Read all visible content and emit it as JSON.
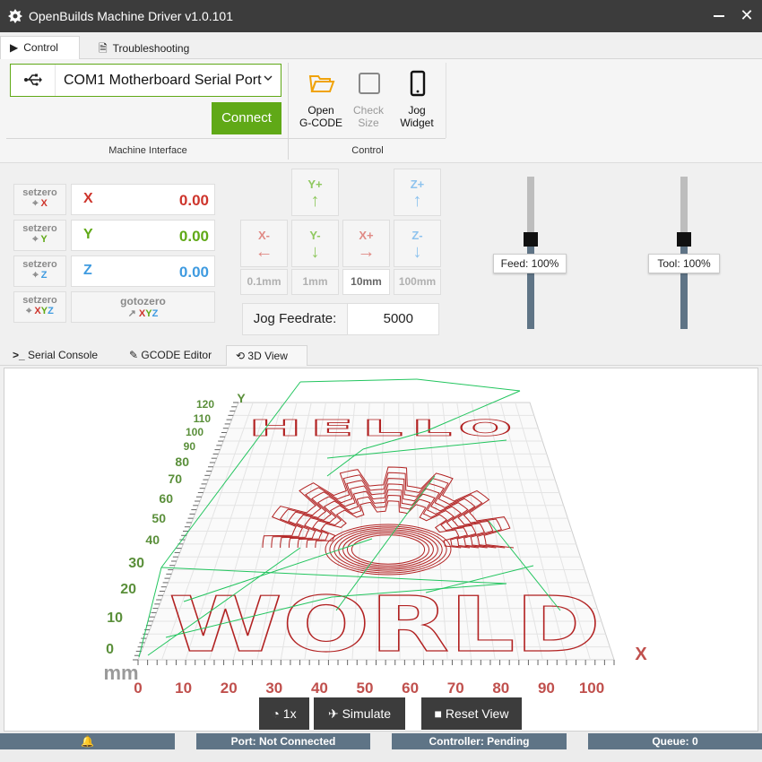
{
  "window": {
    "title": "OpenBuilds Machine Driver v1.0.101",
    "close_glyph": "✕"
  },
  "tabs": [
    {
      "label": "Control",
      "icon": "play-icon"
    },
    {
      "label": "Troubleshooting",
      "icon": "document-icon"
    }
  ],
  "machine": {
    "port_value": "COM1 Motherboard Serial Port",
    "connect_label": "Connect",
    "group_label": "Machine Interface"
  },
  "control": {
    "group_label": "Control",
    "open_label_1": "Open",
    "open_label_2": "G-CODE",
    "check_label_1": "Check",
    "check_label_2": "Size",
    "jog_label_1": "Jog",
    "jog_label_2": "Widget"
  },
  "dro": {
    "setzero_label": "setzero",
    "gotozero_label": "gotozero",
    "axes": [
      {
        "axis": "X",
        "value": "0.00",
        "color": "#ce352c"
      },
      {
        "axis": "Y",
        "value": "0.00",
        "color": "#60a917"
      },
      {
        "axis": "Z",
        "value": "0.00",
        "color": "#3f9be0"
      }
    ],
    "xyz_label": "XYZ"
  },
  "jog": {
    "buttons": {
      "yplus": "Y+",
      "zplus": "Z+",
      "xminus": "X-",
      "yminus": "Y-",
      "xplus": "X+",
      "zminus": "Z-"
    },
    "steps": [
      "0.1mm",
      "1mm",
      "10mm",
      "100mm"
    ],
    "selected_step": "10mm",
    "feedrate_label": "Jog Feedrate:",
    "feedrate_value": "5000"
  },
  "overrides": {
    "feed_label": "Feed: 100%",
    "feed_percent": 100,
    "tool_label": "Tool: 100%",
    "tool_percent": 100
  },
  "subtabs": [
    {
      "label": "Serial Console",
      "icon": "terminal-icon"
    },
    {
      "label": "GCODE Editor",
      "icon": "edit-icon"
    },
    {
      "label": "3D View",
      "icon": "cube-icon"
    }
  ],
  "view3d": {
    "x_axis_label": "X",
    "y_axis_label": "Y",
    "unit_label": "mm",
    "x_ticks": [
      "0",
      "10",
      "20",
      "30",
      "40",
      "50",
      "60",
      "70",
      "80",
      "90",
      "100"
    ],
    "y_ticks": [
      "0",
      "10",
      "20",
      "30",
      "40",
      "50",
      "60",
      "70",
      "80",
      "90",
      "100",
      "110",
      "120"
    ],
    "text_top": "HELLO",
    "text_bottom": "WORLD",
    "speed_label": "1x",
    "simulate_label": "Simulate",
    "reset_label": "Reset View"
  },
  "status": {
    "port": "Port: Not Connected",
    "controller": "Controller: Pending",
    "queue": "Queue: 0"
  },
  "colors": {
    "accent_green": "#60a917",
    "toolpath_red": "#b22222",
    "rapid_green": "#22c55e",
    "status_blue": "#5f7486"
  }
}
